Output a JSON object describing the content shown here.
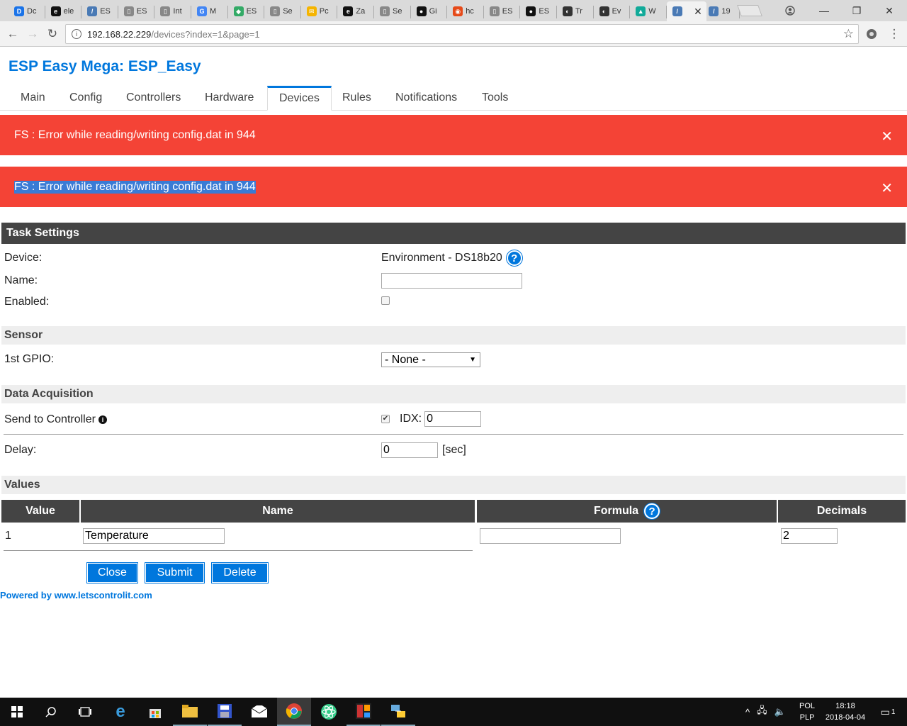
{
  "browser": {
    "tabs": [
      {
        "label": "Dc",
        "color": "#1a73e8",
        "glyph": "D"
      },
      {
        "label": "ele",
        "color": "#111",
        "glyph": "e"
      },
      {
        "label": "ES",
        "color": "#4a7ab5",
        "glyph": "/"
      },
      {
        "label": "ES",
        "color": "#888",
        "glyph": "▯"
      },
      {
        "label": "Int",
        "color": "#888",
        "glyph": "▯"
      },
      {
        "label": "M",
        "color": "#4285f4",
        "glyph": "G"
      },
      {
        "label": "ES",
        "color": "#3a6",
        "glyph": "◆"
      },
      {
        "label": "Se",
        "color": "#888",
        "glyph": "▯"
      },
      {
        "label": "Pc",
        "color": "#f5b400",
        "glyph": "✉"
      },
      {
        "label": "Za",
        "color": "#111",
        "glyph": "e"
      },
      {
        "label": "Se",
        "color": "#888",
        "glyph": "▯"
      },
      {
        "label": "Gi",
        "color": "#111",
        "glyph": "●"
      },
      {
        "label": "hc",
        "color": "#e64a19",
        "glyph": "◉"
      },
      {
        "label": "ES",
        "color": "#888",
        "glyph": "▯"
      },
      {
        "label": "ES",
        "color": "#111",
        "glyph": "●"
      },
      {
        "label": "Tr",
        "color": "#333",
        "glyph": "◐"
      },
      {
        "label": "Ev",
        "color": "#333",
        "glyph": "◐"
      },
      {
        "label": "W",
        "color": "#1a9",
        "glyph": "▲"
      },
      {
        "label": "",
        "color": "#4a7ab5",
        "glyph": "/"
      },
      {
        "label": "19",
        "color": "#4a7ab5",
        "glyph": "/"
      }
    ],
    "active_tab_index": 18,
    "url_host": "192.168.22.229",
    "url_path": "/devices?index=1&page=1"
  },
  "app": {
    "title": "ESP Easy Mega: ESP_Easy",
    "menu": [
      "Main",
      "Config",
      "Controllers",
      "Hardware",
      "Devices",
      "Rules",
      "Notifications",
      "Tools"
    ],
    "active_menu": "Devices"
  },
  "alerts": [
    {
      "text": "FS : Error while reading/writing config.dat in 944"
    },
    {
      "text": "FS : Error while reading/writing config.dat in 944"
    }
  ],
  "task": {
    "header": "Task Settings",
    "device_label": "Device:",
    "device_value": "Environment - DS18b20",
    "name_label": "Name:",
    "name_value": "",
    "enabled_label": "Enabled:",
    "sensor_header": "Sensor",
    "gpio_label": "1st GPIO:",
    "gpio_value": "- None -",
    "acq_header": "Data Acquisition",
    "send_label": "Send to Controller",
    "idx_label": "IDX:",
    "idx_value": "0",
    "delay_label": "Delay:",
    "delay_value": "0",
    "delay_unit": "[sec]",
    "values_header": "Values",
    "columns": [
      "Value",
      "Name",
      "Formula",
      "Decimals"
    ],
    "rows": [
      {
        "value": "1",
        "name": "Temperature",
        "formula": "",
        "decimals": "2"
      }
    ],
    "buttons": {
      "close": "Close",
      "submit": "Submit",
      "delete": "Delete"
    },
    "powered": "Powered by www.letscontrolit.com"
  },
  "taskbar": {
    "lang_top": "POL",
    "lang_bottom": "PLP",
    "time": "18:18",
    "date": "2018-04-04",
    "notif_count": "1"
  }
}
